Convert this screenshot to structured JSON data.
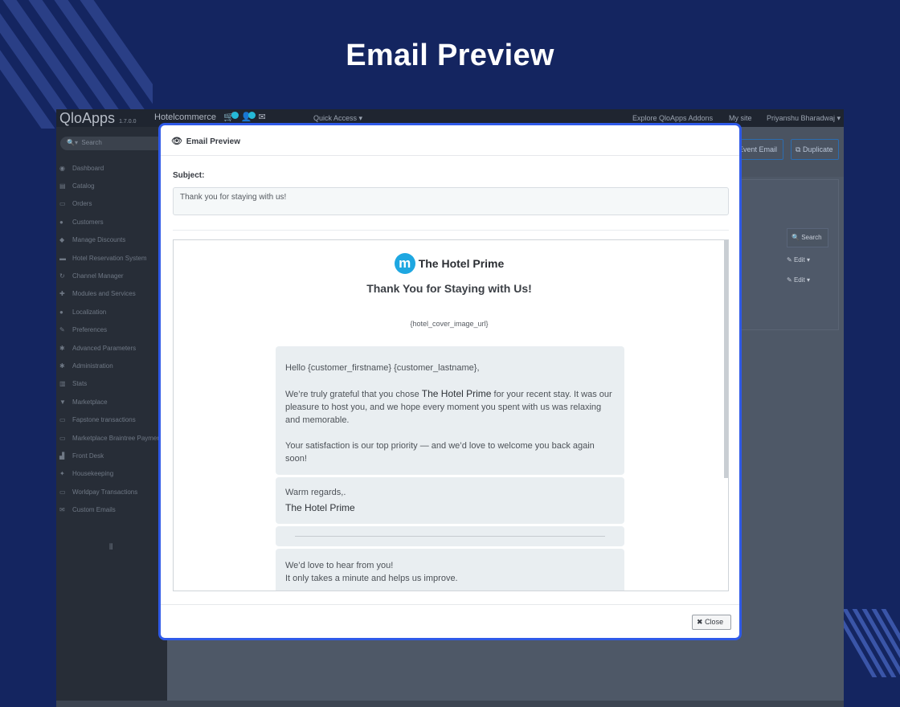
{
  "page": {
    "heading": "Email Preview"
  },
  "admin": {
    "logo": "QloApps",
    "version": "1.7.0.0",
    "shop_name": "Hotelcommerce",
    "quick_access": "Quick Access ▾",
    "explore": "Explore QloApps Addons",
    "my_site": "My site",
    "user": "Priyanshu Bharadwaj ▾",
    "search_placeholder": "Search",
    "sidebar": [
      {
        "icon": "dashboard-icon",
        "label": "Dashboard"
      },
      {
        "icon": "catalog-icon",
        "label": "Catalog"
      },
      {
        "icon": "orders-icon",
        "label": "Orders"
      },
      {
        "icon": "customers-icon",
        "label": "Customers"
      },
      {
        "icon": "discounts-icon",
        "label": "Manage Discounts"
      },
      {
        "icon": "bed-icon",
        "label": "Hotel Reservation System"
      },
      {
        "icon": "channel-icon",
        "label": "Channel Manager"
      },
      {
        "icon": "modules-icon",
        "label": "Modules and Services"
      },
      {
        "icon": "globe-icon",
        "label": "Localization"
      },
      {
        "icon": "wrench-icon",
        "label": "Preferences"
      },
      {
        "icon": "cogs-icon",
        "label": "Advanced Parameters"
      },
      {
        "icon": "gear-icon",
        "label": "Administration"
      },
      {
        "icon": "stats-icon",
        "label": "Stats"
      },
      {
        "icon": "cart-icon",
        "label": "Marketplace"
      },
      {
        "icon": "card-icon",
        "label": "Fapstone transactions"
      },
      {
        "icon": "card-icon",
        "label": "Marketplace Braintree Payments"
      },
      {
        "icon": "desk-icon",
        "label": "Front Desk"
      },
      {
        "icon": "broom-icon",
        "label": "Housekeeping"
      },
      {
        "icon": "card-icon",
        "label": "Worldpay Transactions"
      },
      {
        "icon": "mail-icon",
        "label": "Custom Emails"
      }
    ],
    "toolbar": {
      "event_email": "Event Email",
      "duplicate": "Duplicate"
    },
    "panel": {
      "search": "Search",
      "edit": "Edit"
    }
  },
  "modal": {
    "title": "Email Preview",
    "subject_label": "Subject:",
    "subject_value": "Thank you for staying with us!",
    "email": {
      "brand_logo_letter": "m",
      "brand_name": "The Hotel Prime",
      "title": "Thank You for Staying with Us!",
      "cover_placeholder": "{hotel_cover_image_url}",
      "greeting": "Hello {customer_firstname} {customer_lastname},",
      "p1_before": "We’re truly grateful that you chose ",
      "p1_hotel": "The Hotel Prime",
      "p1_after": " for your recent stay. It was our pleasure to host you, and we hope every moment you spent with us was relaxing and memorable.",
      "p2": "Your satisfaction is our top priority — and we’d love to welcome you back again soon!",
      "regards": "Warm regards,.",
      "signature": "The Hotel Prime",
      "feedback_line1": "We’d love to hear from you!",
      "feedback_line2": "It only takes a minute and helps us improve."
    },
    "close_label": "Close"
  }
}
